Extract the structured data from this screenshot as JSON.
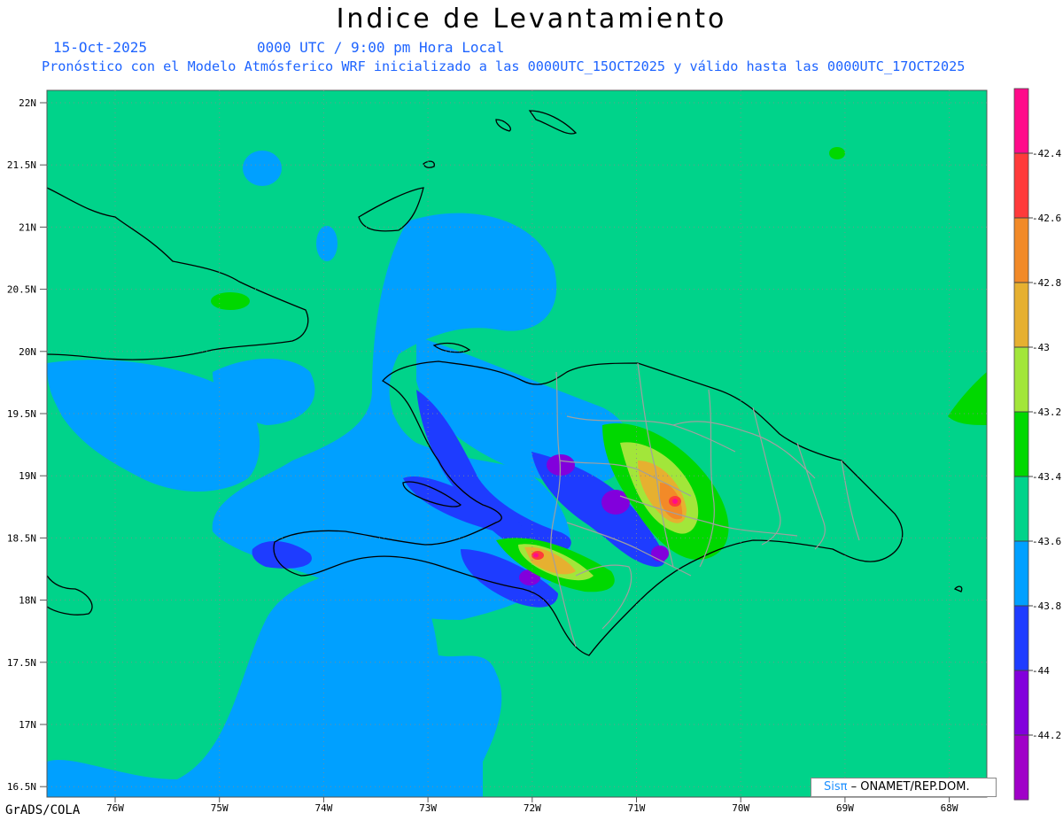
{
  "header": {
    "title": "Indice de Levantamiento",
    "date": "15-Oct-2025",
    "time": "0000 UTC / 9:00 pm Hora Local",
    "description": "Pronóstico con el Modelo Atmósferico WRF inicializado a las 0000UTC_15OCT2025 y válido hasta las  0000UTC_17OCT2025"
  },
  "map": {
    "lat_labels": [
      "22N",
      "21.5N",
      "21N",
      "20.5N",
      "20N",
      "19.5N",
      "19N",
      "18.5N",
      "18N",
      "17.5N",
      "17N",
      "16.5N"
    ],
    "lon_labels": [
      "76W",
      "75W",
      "74W",
      "73W",
      "72W",
      "71W",
      "70W",
      "69W",
      "68W"
    ],
    "background_color": "#00d38a"
  },
  "colorbar": {
    "labels": [
      "-42.4",
      "-42.6",
      "-42.8",
      "-43",
      "-43.2",
      "-43.4",
      "-43.6",
      "-43.8",
      "-44",
      "-44.2"
    ],
    "colors": [
      "#ff0b8a",
      "#ff3a3a",
      "#f28a28",
      "#e6b030",
      "#a2e63a",
      "#00d800",
      "#00d38a",
      "#00a0ff",
      "#1e3cff",
      "#8200dc",
      "#a000c8"
    ]
  },
  "footer": {
    "credit": "GrADS/COLA",
    "logo_sis": "Sisπ",
    "logo_org": " – ONAMET/REP.DOM."
  }
}
